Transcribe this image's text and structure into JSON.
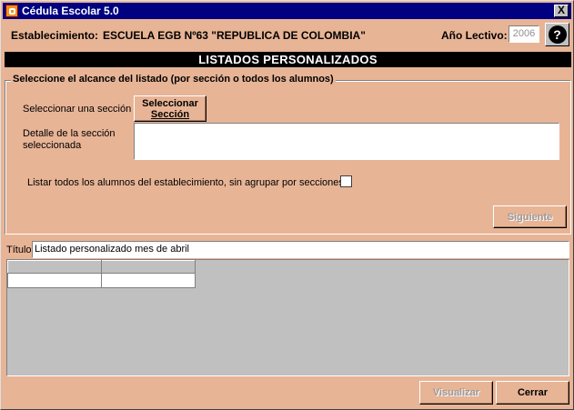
{
  "window": {
    "title": "Cédula Escolar 5.0",
    "close_label": "X"
  },
  "header": {
    "establecimiento_label": "Establecimiento:",
    "establecimiento_name": "ESCUELA EGB Nº63 \"REPUBLICA DE COLOMBIA\"",
    "anio_label": "Año Lectivo:",
    "anio_value": "2006",
    "help_label": "?"
  },
  "banner": "LISTADOS PERSONALIZADOS",
  "scope_group": {
    "legend": "Seleccione el alcance del listado (por sección o todos los alumnos)",
    "select_section_label": "Seleccionar una sección",
    "select_section_button_line1": "Seleccionar",
    "select_section_button_line2": "Sección",
    "detail_label_line1": "Detalle de la sección",
    "detail_label_line2": "seleccionada",
    "detail_value": "",
    "all_students_label": "Listar todos los alumnos del establecimiento, sin agrupar por secciones",
    "all_students_checked": false,
    "next_button": "Siguiente"
  },
  "titulo": {
    "label": "Título",
    "value": "Listado personalizado mes de abril"
  },
  "grid": {
    "columns": [
      "",
      ""
    ],
    "rows": [
      [
        "",
        ""
      ]
    ]
  },
  "footer": {
    "visualizar_button": "Visualizar",
    "cerrar_button": "Cerrar"
  },
  "colors": {
    "window_bg": "#e8b496",
    "titlebar": "#000080",
    "banner": "#000000"
  }
}
